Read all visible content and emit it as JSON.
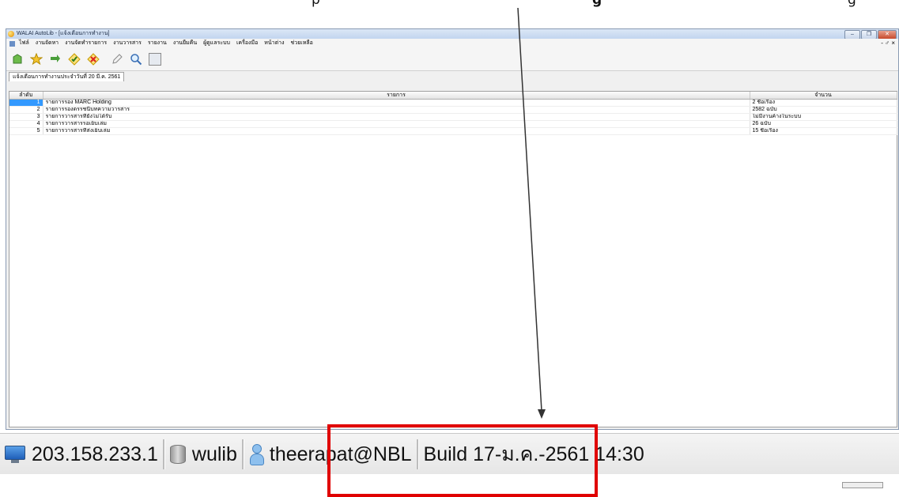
{
  "caption": {
    "part1": "p",
    "part2": "g",
    "part3": "g"
  },
  "window": {
    "title": "WALAI AutoLib - [แจ้งเตือนการทำงาน]",
    "controls": [
      "–",
      "❐",
      "✕"
    ]
  },
  "menu": {
    "items": [
      "ไฟล์",
      "งานจัดหา",
      "งานจัดทำรายการ",
      "งานวารสาร",
      "รายงาน",
      "งานยืมคืน",
      "ผู้ดูแลระบบ",
      "เครื่องมือ",
      "หน้าต่าง",
      "ช่วยเหลือ"
    ],
    "mdi_controls": "- ♂ ×"
  },
  "tab": {
    "label": "แจ้งเตือนการทำงานประจำวันที่ 20 มี.ค. 2561"
  },
  "table": {
    "headers": [
      "ลำดับ",
      "รายการ",
      "จำนวน"
    ],
    "rows": [
      {
        "num": "1",
        "item": "รายการรอง MARC Holding",
        "count": "2 ชื่อเรื่อง"
      },
      {
        "num": "2",
        "item": "รายการรองดรรชนีบทความวารสาร",
        "count": "2582 ฉบับ"
      },
      {
        "num": "3",
        "item": "รายการวารสารที่ยังไม่ได้รับ",
        "count": "ไม่มีงานค้างในระบบ"
      },
      {
        "num": "4",
        "item": "รายการวารสารรอเย็บเล่ม",
        "count": "26 ฉบับ"
      },
      {
        "num": "5",
        "item": "รายการวารสารที่ส่งเย็บเล่ม",
        "count": "15 ชื่อเรื่อง"
      }
    ]
  },
  "status": {
    "ip": "203.158.233.1",
    "database": "wulib",
    "user": "theerapat@NBL",
    "build": "Build 17-ม.ค.-2561 14:30"
  }
}
